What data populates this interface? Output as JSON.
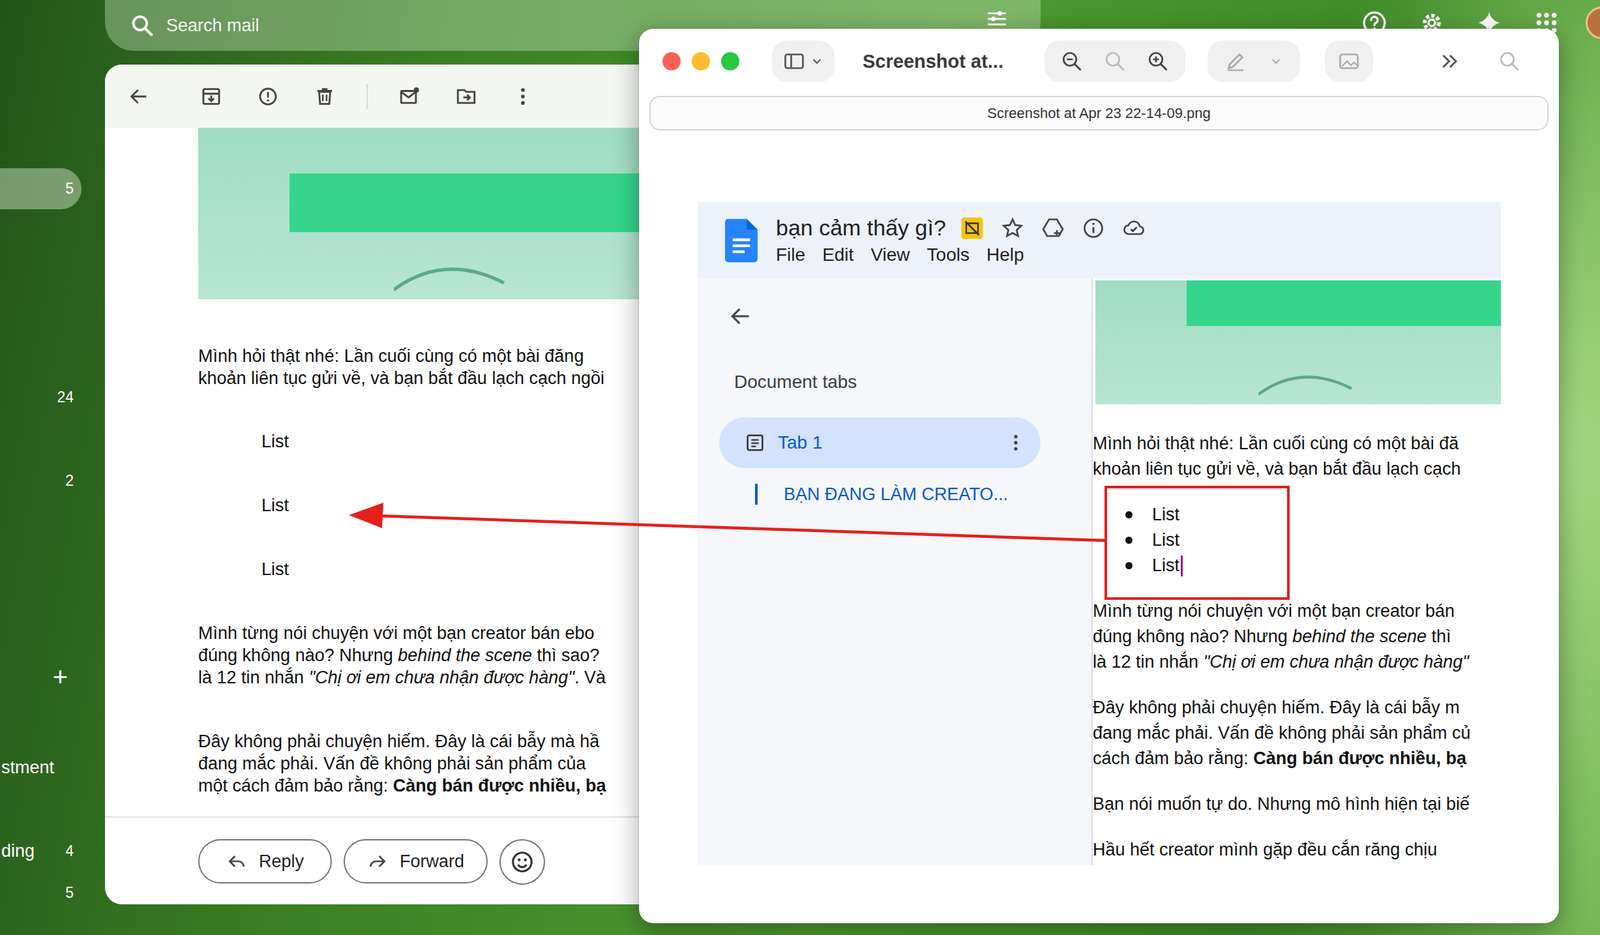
{
  "gmail": {
    "search_placeholder": "Search mail",
    "nav_items": [
      {
        "kind": "folder",
        "label": "",
        "count": "5",
        "selected": true
      },
      {
        "kind": "folder",
        "label": "",
        "count": "24",
        "selected": false
      },
      {
        "kind": "folder",
        "label": "",
        "count": "2",
        "selected": false
      },
      {
        "kind": "add",
        "label": "+",
        "count": "",
        "selected": false
      },
      {
        "kind": "folder",
        "label": "stment",
        "count": "",
        "selected": false
      },
      {
        "kind": "folder",
        "label": "ding",
        "count": "4",
        "selected": false
      },
      {
        "kind": "folder",
        "label": "",
        "count": "5",
        "selected": false
      }
    ],
    "email": {
      "blocks": [
        {
          "kind": "paragraph",
          "lines": [
            [
              {
                "text": "Mình hỏi thật nhé: Lần cuối cùng có một bài đăng",
                "kind": "normal"
              }
            ],
            [
              {
                "text": "khoản liên tục gửi về, và bạn bắt đầu lạch cạch ngồi",
                "kind": "normal"
              }
            ]
          ],
          "items": []
        },
        {
          "kind": "list",
          "lines": [],
          "items": [
            {
              "text": "List",
              "has_cursor": false
            },
            {
              "text": "List",
              "has_cursor": false
            },
            {
              "text": "List",
              "has_cursor": false
            }
          ]
        },
        {
          "kind": "paragraph",
          "lines": [
            [
              {
                "text": "Mình từng nói chuyện với một bạn creator bán ebo",
                "kind": "normal"
              }
            ],
            [
              {
                "text": "đúng không nào? Nhưng ",
                "kind": "normal"
              },
              {
                "text": "behind the scene",
                "kind": "italic"
              },
              {
                "text": " thì sao?",
                "kind": "normal"
              }
            ],
            [
              {
                "text": "là 12 tin nhắn ",
                "kind": "normal"
              },
              {
                "text": "\"Chị ơi em chưa nhận được hàng\"",
                "kind": "italic"
              },
              {
                "text": ". Và",
                "kind": "normal"
              }
            ]
          ],
          "items": []
        },
        {
          "kind": "paragraph",
          "lines": [
            [
              {
                "text": "Đây không phải chuyện hiếm. Đây là cái bẫy mà hầ",
                "kind": "normal"
              }
            ],
            [
              {
                "text": "đang mắc phải. Vấn đề không phải sản phẩm của",
                "kind": "normal"
              }
            ],
            [
              {
                "text": "một cách đảm bảo rằng: ",
                "kind": "normal"
              },
              {
                "text": "Càng bán được nhiều, bạ",
                "kind": "bold"
              }
            ]
          ],
          "items": []
        }
      ]
    },
    "actions": [
      "Reply",
      "Forward"
    ]
  },
  "preview": {
    "title": "Screenshot at...",
    "path": "Screenshot at Apr 23 22-14-09.png",
    "document": {
      "title": "bạn cảm thấy gì?",
      "menu": [
        "File",
        "Edit",
        "View",
        "Tools",
        "Help"
      ],
      "tabs_heading": "Document tabs",
      "tabs": [
        {
          "label": "Tab 1",
          "selected": true
        }
      ],
      "outline": [
        "BẠN ĐANG LÀM CREATO..."
      ],
      "blocks": [
        {
          "kind": "paragraph",
          "lines": [
            [
              {
                "text": "Mình hỏi thật nhé: Lần cuối cùng có một bài đă",
                "kind": "normal"
              }
            ],
            [
              {
                "text": "khoản liên tục gửi về, và bạn bắt đầu lạch cạch",
                "kind": "normal"
              }
            ]
          ],
          "items": []
        },
        {
          "kind": "list",
          "lines": [],
          "items": [
            {
              "text": "List",
              "has_cursor": false
            },
            {
              "text": "List",
              "has_cursor": false
            },
            {
              "text": "List",
              "has_cursor": true
            }
          ]
        },
        {
          "kind": "paragraph",
          "lines": [
            [
              {
                "text": "Mình từng nói chuyện với một bạn creator bán",
                "kind": "normal"
              }
            ],
            [
              {
                "text": "đúng không nào? Nhưng ",
                "kind": "normal"
              },
              {
                "text": "behind the scene",
                "kind": "italic"
              },
              {
                "text": " thì",
                "kind": "normal"
              }
            ],
            [
              {
                "text": "là 12 tin nhắn ",
                "kind": "normal"
              },
              {
                "text": "\"Chị ơi em chưa nhận được hàng\"",
                "kind": "italic"
              }
            ]
          ],
          "items": []
        },
        {
          "kind": "paragraph",
          "lines": [
            [
              {
                "text": "Đây không phải chuyện hiếm. Đây là cái bẫy m",
                "kind": "normal"
              }
            ],
            [
              {
                "text": "đang mắc phải. Vấn đề không phải sản phẩm củ",
                "kind": "normal"
              }
            ],
            [
              {
                "text": "cách đảm bảo rằng: ",
                "kind": "normal"
              },
              {
                "text": "Càng bán được nhiều, bạ",
                "kind": "bold"
              }
            ]
          ],
          "items": []
        },
        {
          "kind": "paragraph",
          "lines": [
            [
              {
                "text": "Bạn nói muốn tự do. Nhưng mô hình hiện tại biế",
                "kind": "normal"
              }
            ]
          ],
          "items": []
        },
        {
          "kind": "paragraph",
          "lines": [
            [
              {
                "text": "Hầu hết creator mình gặp đều cắn răng chịu",
                "kind": "normal"
              }
            ]
          ],
          "items": []
        }
      ]
    }
  }
}
